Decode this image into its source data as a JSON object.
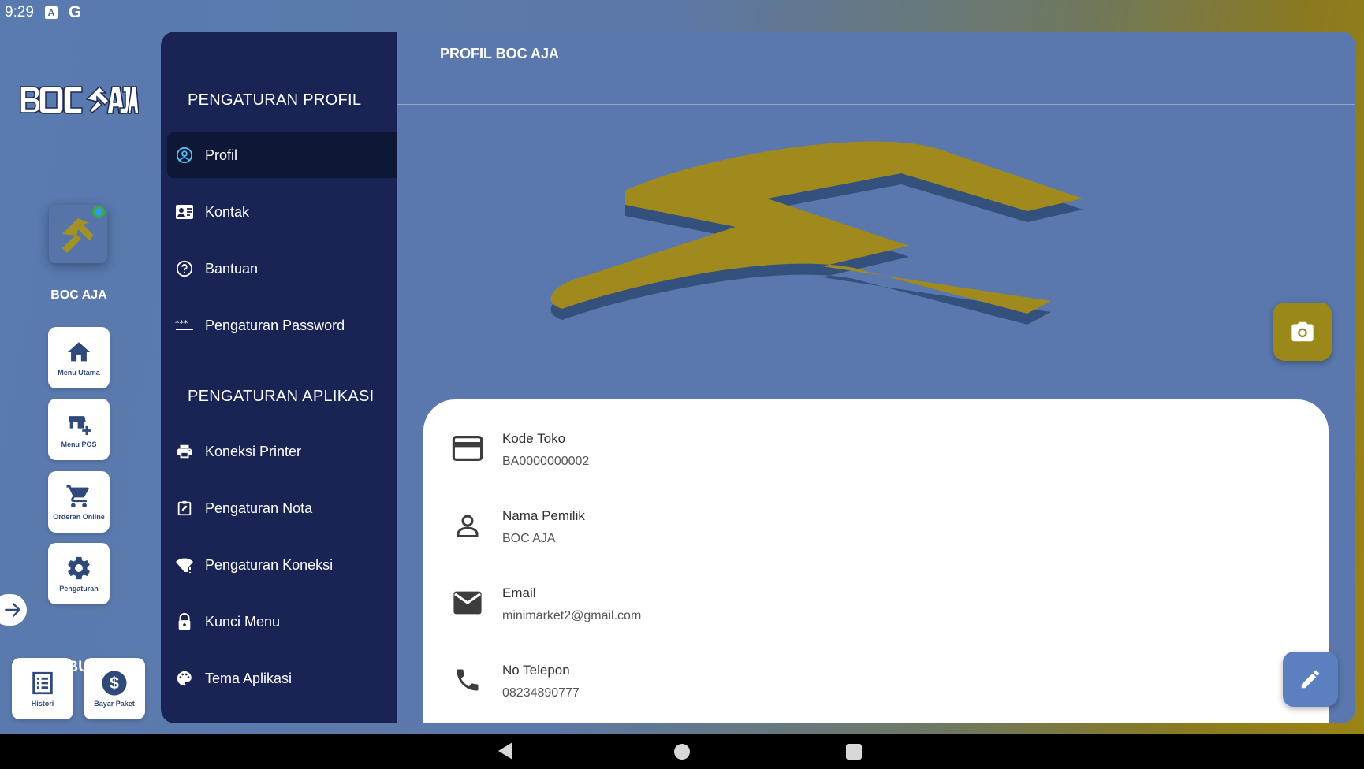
{
  "status_bar": {
    "time": "9:29",
    "icons": [
      "a-notification-icon",
      "google-icon"
    ]
  },
  "rail": {
    "brand": "BOC AJA",
    "user_name": "BOC AJA",
    "buttons": [
      {
        "label": "Menu Utama",
        "icon": "home-icon"
      },
      {
        "label": "Menu POS",
        "icon": "store-add-icon"
      },
      {
        "label": "Orderan Online",
        "icon": "cart-icon"
      },
      {
        "label": "Pengaturan",
        "icon": "gear-icon"
      }
    ],
    "paket_title": "PAKET BUSINESS",
    "paket_buttons": [
      {
        "label": "Histori",
        "icon": "list-icon"
      },
      {
        "label": "Bayar Paket",
        "icon": "dollar-icon"
      }
    ]
  },
  "settings_menu": {
    "section_profile": "PENGATURAN PROFIL",
    "profile_items": [
      {
        "label": "Profil",
        "icon": "account-circle-icon",
        "active": true
      },
      {
        "label": "Kontak",
        "icon": "contact-card-icon"
      },
      {
        "label": "Bantuan",
        "icon": "help-icon"
      },
      {
        "label": "Pengaturan Password",
        "icon": "password-icon"
      }
    ],
    "section_app": "PENGATURAN APLIKASI",
    "app_items": [
      {
        "label": "Koneksi Printer",
        "icon": "printer-icon"
      },
      {
        "label": "Pengaturan Nota",
        "icon": "receipt-edit-icon"
      },
      {
        "label": "Pengaturan Koneksi",
        "icon": "wifi-alert-icon"
      },
      {
        "label": "Kunci Menu",
        "icon": "lock-icon"
      },
      {
        "label": "Tema Aplikasi",
        "icon": "palette-icon"
      }
    ]
  },
  "content": {
    "title": "PROFIL BOC AJA",
    "fields": [
      {
        "label": "Kode Toko",
        "value": "BA0000000002",
        "icon": "card-icon"
      },
      {
        "label": "Nama Pemilik",
        "value": "BOC AJA",
        "icon": "person-icon"
      },
      {
        "label": "Email",
        "value": "minimarket2@gmail.com",
        "icon": "email-icon"
      },
      {
        "label": "No Telepon",
        "value": "08234890777",
        "icon": "phone-icon"
      }
    ]
  },
  "colors": {
    "gold": "#a08a1e",
    "navy": "#192454",
    "blue": "#5a78ad"
  }
}
